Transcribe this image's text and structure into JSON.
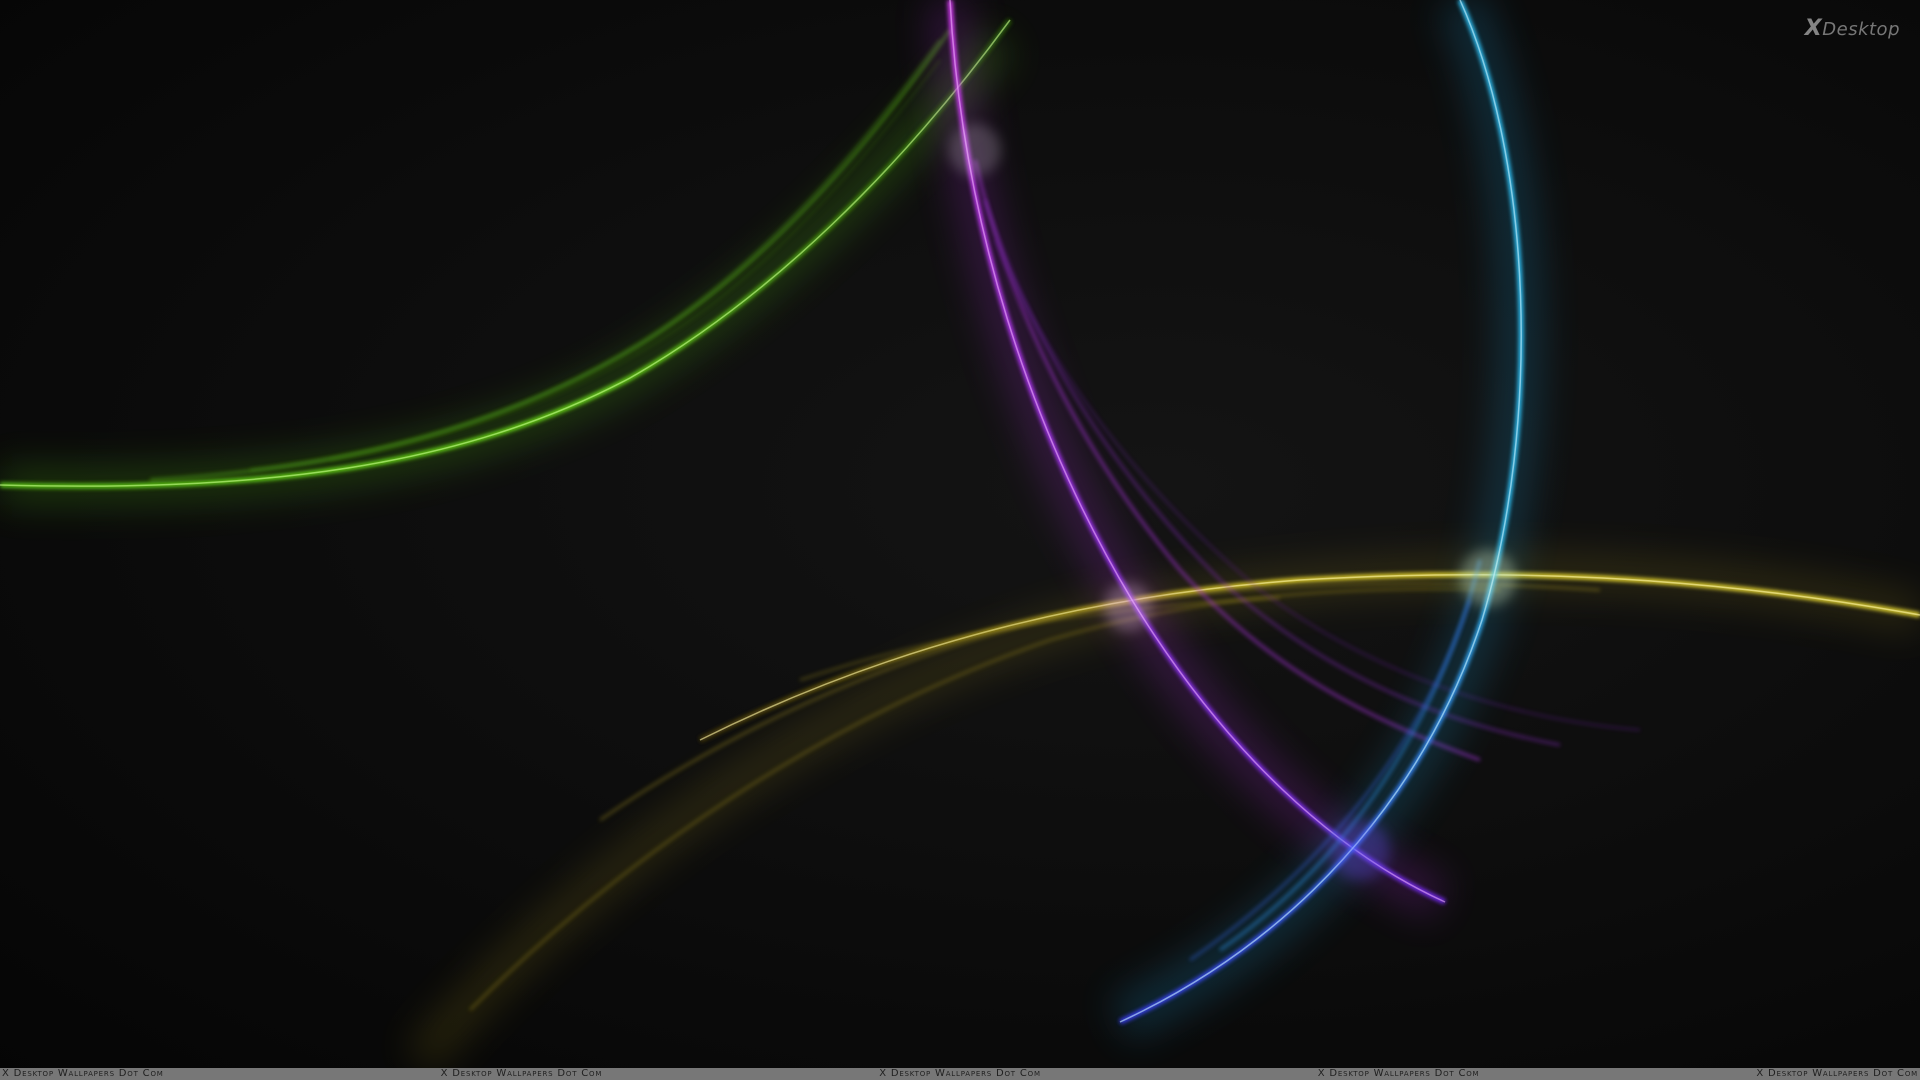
{
  "logo": {
    "mark": "X",
    "text": "Desktop"
  },
  "footer": {
    "items": [
      "X Desktop Wallpapers Dot Com",
      "X Desktop Wallpapers Dot Com",
      "X Desktop Wallpapers Dot Com",
      "X Desktop Wallpapers Dot Com",
      "X Desktop Wallpapers Dot Com"
    ]
  },
  "colors": {
    "background": "#0b0b0b",
    "green": "#6ee21a",
    "magenta": "#d633ff",
    "cyan": "#2ec8ff",
    "blue": "#3a5cff",
    "yellow": "#f2e233",
    "footer_bar": "#777777"
  }
}
